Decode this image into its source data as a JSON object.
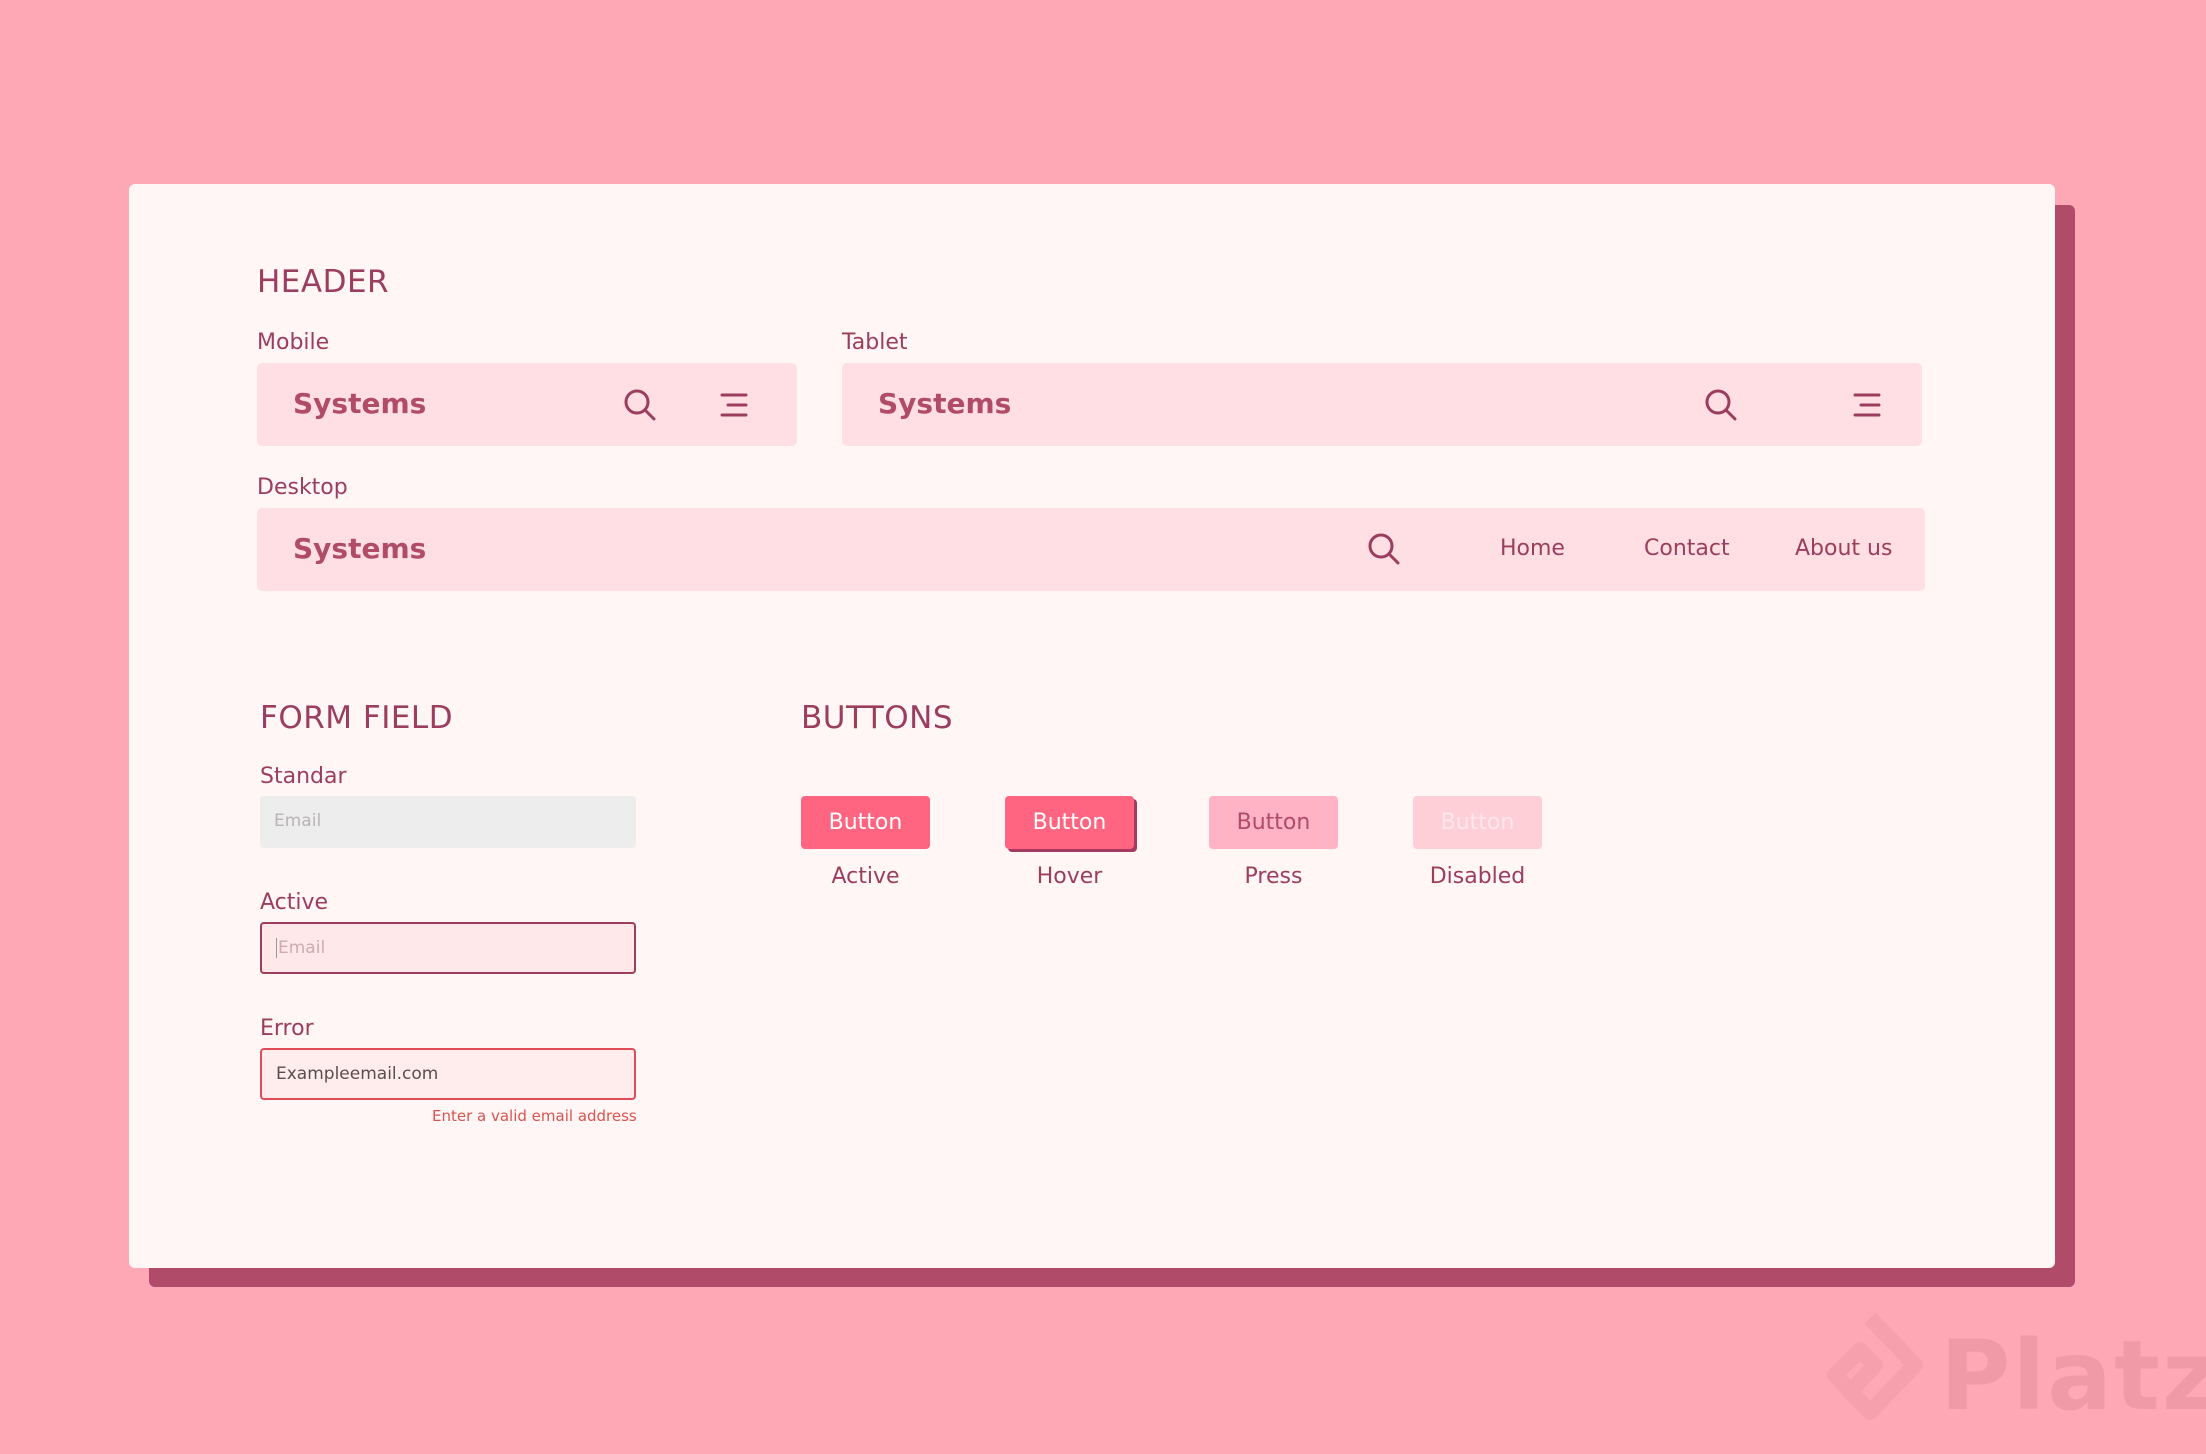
{
  "header": {
    "title": "HEADER",
    "mobile": {
      "label": "Mobile",
      "brand": "Systems"
    },
    "tablet": {
      "label": "Tablet",
      "brand": "Systems"
    },
    "desktop": {
      "label": "Desktop",
      "brand": "Systems",
      "nav": [
        "Home",
        "Contact",
        "About us"
      ]
    }
  },
  "form": {
    "title": "FORM FIELD",
    "standar": {
      "label": "Standar",
      "placeholder": "Email"
    },
    "active": {
      "label": "Active",
      "placeholder": "Email"
    },
    "error": {
      "label": "Error",
      "value": "Exampleemail.com",
      "message": "Enter a valid email address"
    }
  },
  "buttons": {
    "title": "BUTTONS",
    "items": [
      {
        "label": "Button",
        "caption": "Active"
      },
      {
        "label": "Button",
        "caption": "Hover"
      },
      {
        "label": "Button",
        "caption": "Press"
      },
      {
        "label": "Button",
        "caption": "Disabled"
      }
    ]
  },
  "watermark": "Platzi",
  "colors": {
    "background": "#FEA8B5",
    "card": "#FFF6F5",
    "card_shadow": "#B14B6A",
    "bar": "#FFDFE3",
    "text": "#9B3D5F",
    "button_active": "#FF6581",
    "button_press": "#FFB3C4",
    "button_disabled": "#FFCFD7",
    "error": "#E04C57"
  }
}
